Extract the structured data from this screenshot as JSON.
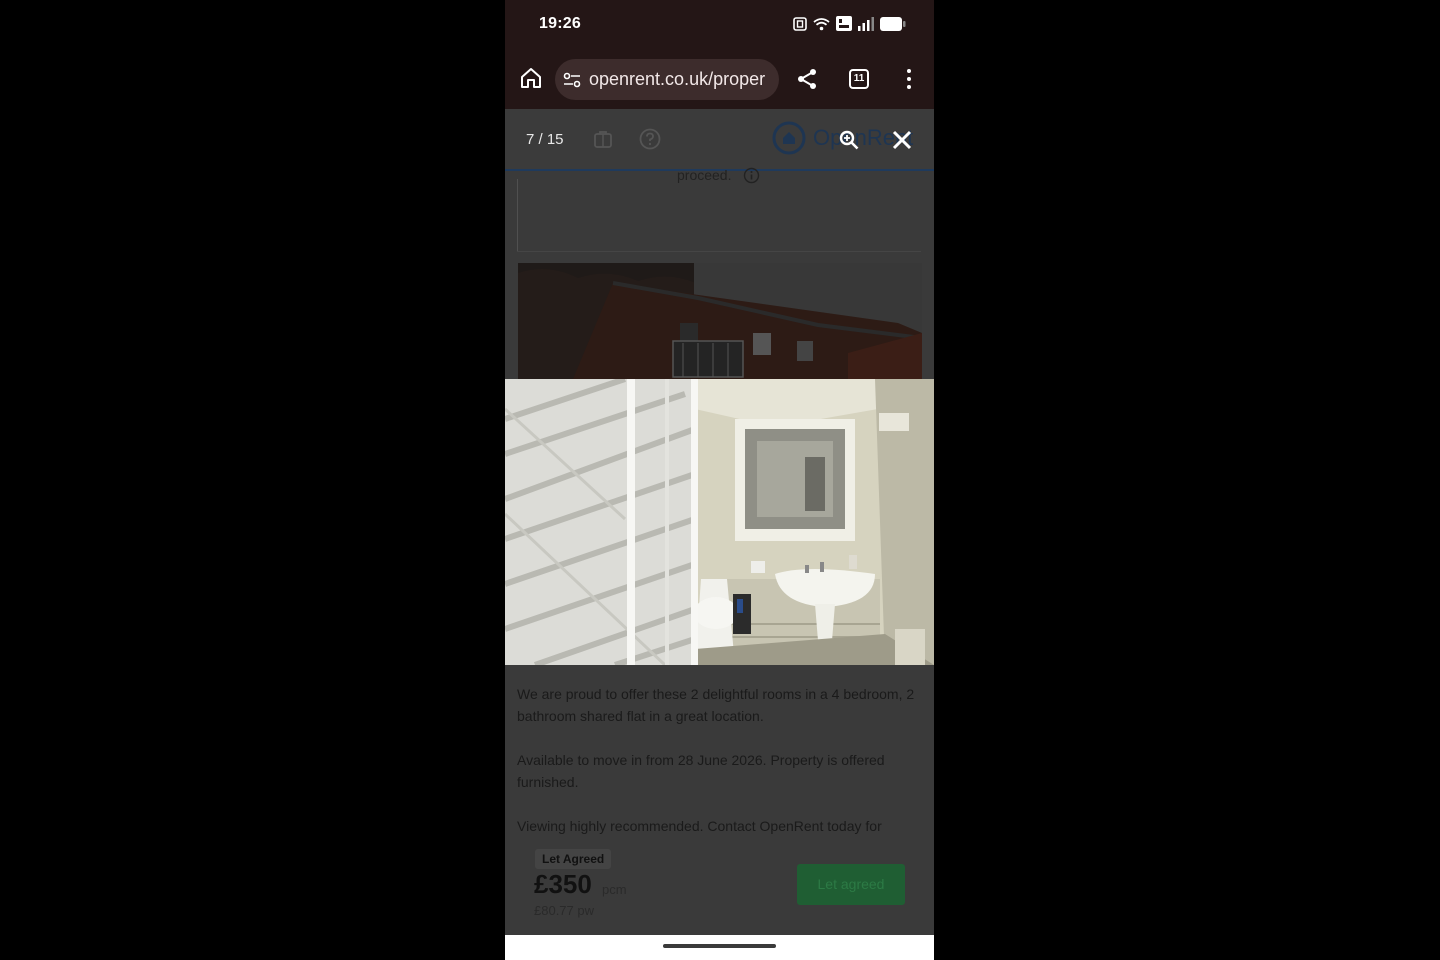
{
  "status_bar": {
    "time": "19:26",
    "icons": [
      "nfc-icon",
      "wifi-icon",
      "volte-icon",
      "signal-icon",
      "battery-icon"
    ]
  },
  "browser": {
    "url": "openrent.co.uk/proper",
    "tab_count": "11"
  },
  "gallery": {
    "counter": "7 / 15",
    "logo_text": "OpenRent"
  },
  "page": {
    "proceed_text": "proceed.",
    "description": [
      "We are proud to offer these 2 delightful rooms in a 4 bedroom, 2 bathroom shared flat in a great location.",
      "Available to move in from 28 June 2026. Property is offered furnished.",
      "Viewing highly recommended. Contact OpenRent today for"
    ]
  },
  "listing": {
    "status": "Let Agreed",
    "price": "£350",
    "price_unit": "pcm",
    "price_weekly": "£80.77 pw",
    "button_label": "Let agreed"
  },
  "colors": {
    "brand_blue": "#1e3552",
    "button_green": "#1f5e33"
  }
}
